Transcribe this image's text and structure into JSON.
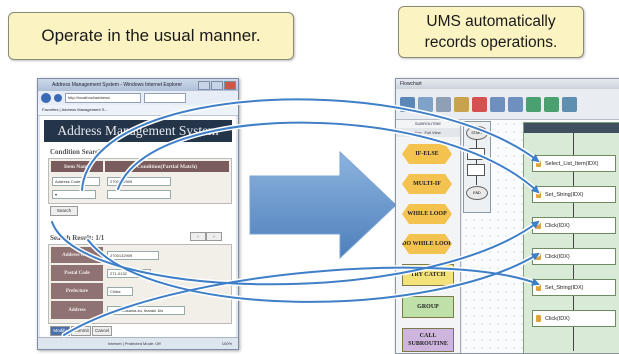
{
  "callouts": {
    "left": "Operate in the usual manner.",
    "right": "UMS automatically\nrecords operations."
  },
  "browser": {
    "title": "Address Management System - Windows Internet Explorer",
    "address": "http://localhost/address/",
    "favorites": "Favorites | Address Management S...",
    "page_heading": "Address Management System",
    "search_section": "Condition Search",
    "col_item_name": "Item Name",
    "col_condition": "Condition(Partial Match)",
    "row_select": "Address Code",
    "row_value": "2700132909",
    "search_button": "Search",
    "result_section": "Search Result: 1/1",
    "fields": [
      {
        "label": "Address Code",
        "value": "2700132909"
      },
      {
        "label": "Postal Code",
        "value": "271-0132"
      },
      {
        "label": "Prefecture",
        "value": "Chiba"
      },
      {
        "label": "Address",
        "value": "Inzai, Ichikawa-ku, Ibaraki 1lls"
      }
    ],
    "buttons": [
      "Modify",
      "Commit",
      "Cancel"
    ],
    "status": "Internet | Protected Mode: Off",
    "zoom": "100%"
  },
  "ums": {
    "title": "Flowchart",
    "palette_title": "SUBROUTINE",
    "palette_tabs": [
      "Tools",
      "Action",
      "Full View"
    ],
    "palette_items": [
      {
        "label": "IF-ELSE",
        "shape": "hex",
        "color": "#f3c24f"
      },
      {
        "label": "MULTI-IF",
        "shape": "hex",
        "color": "#f3c24f"
      },
      {
        "label": "WHILE LOOP",
        "shape": "hex",
        "color": "#f3c24f"
      },
      {
        "label": "DO WHILE LOOP",
        "shape": "hex",
        "color": "#f3c24f"
      },
      {
        "label": "TRY CATCH",
        "shape": "rect",
        "color": "#f3e27a"
      },
      {
        "label": "GROUP",
        "shape": "rect",
        "color": "#bfe0a8"
      },
      {
        "label": "CALL SUBROUTINE",
        "shape": "rect",
        "color": "#cdb5dd"
      }
    ],
    "mini_nodes": [
      "START",
      "END"
    ],
    "steps": [
      "Select_List_Item(IDX)",
      "Set_String(IDX)",
      "Click(IDX)",
      "Click(IDX)",
      "Set_String(IDX)",
      "Click(IDX)"
    ]
  },
  "colors": {
    "callout_fill": "#fbf3c2",
    "arrow": "#5b8fc9",
    "flow_lines": "#3f7fc7"
  }
}
